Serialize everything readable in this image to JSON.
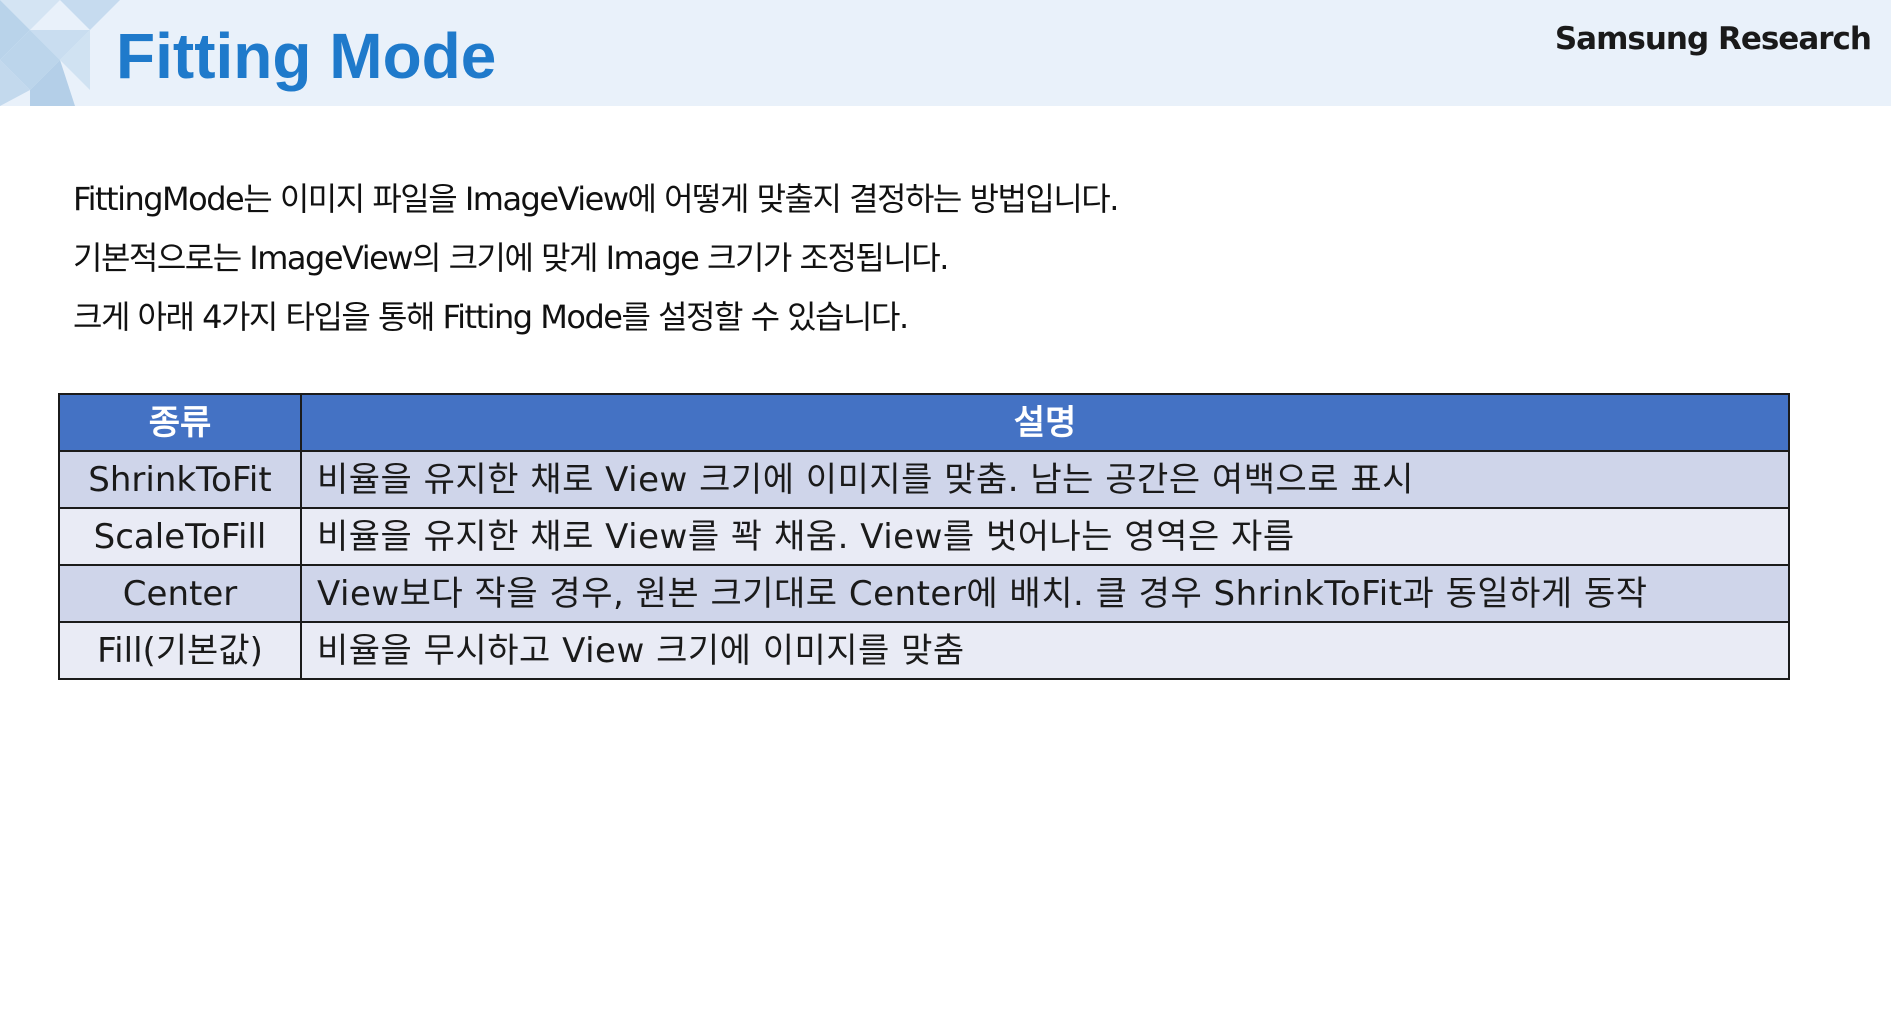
{
  "header": {
    "title": "Fitting Mode",
    "brand": "Samsung Research",
    "colors": {
      "band": "#e9f1fa",
      "title": "#1f7acb",
      "decoration": [
        "#b9d3ea",
        "#d4e4f3"
      ]
    }
  },
  "intro": {
    "lines": [
      "FittingMode는 이미지 파일을 ImageView에 어떻게 맞출지 결정하는 방법입니다.",
      "기본적으로는 ImageView의 크기에 맞게 Image 크기가 조정됩니다.",
      "크게 아래 4가지 타입을 통해 Fitting Mode를 설정할 수 있습니다."
    ]
  },
  "table": {
    "headers": [
      "종류",
      "설명"
    ],
    "rows": [
      {
        "type": "ShrinkToFit",
        "description": "비율을 유지한 채로 View 크기에 이미지를 맞춤. 남는 공간은 여백으로 표시"
      },
      {
        "type": "ScaleToFill",
        "description": "비율을 유지한 채로 View를 꽉 채움. View를 벗어나는 영역은 자름"
      },
      {
        "type": "Center",
        "description": "View보다 작을 경우, 원본 크기대로 Center에 배치. 클 경우 ShrinkToFit과 동일하게 동작"
      },
      {
        "type": "Fill(기본값)",
        "description": "비율을 무시하고 View 크기에 이미지를 맞춤"
      }
    ],
    "colors": {
      "header_bg": "#4472c4",
      "row_odd_bg": "#cfd5ea",
      "row_even_bg": "#e9ebf5"
    }
  }
}
